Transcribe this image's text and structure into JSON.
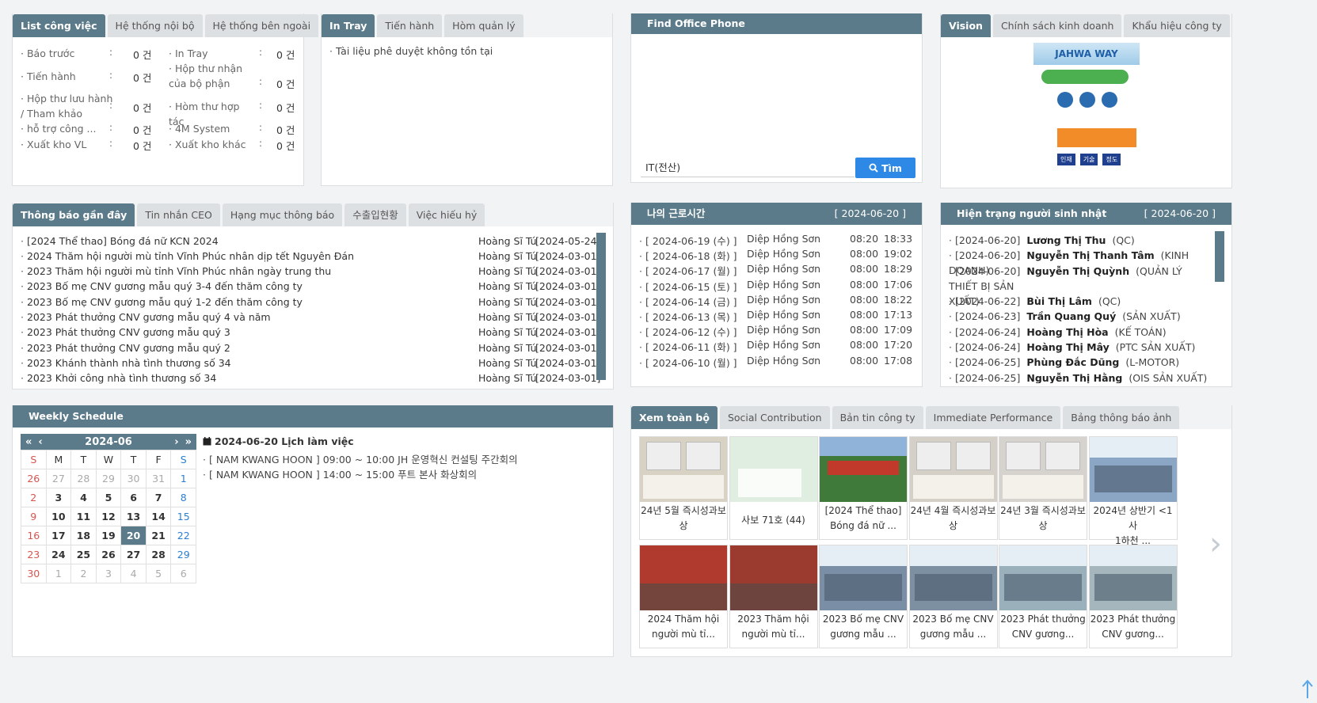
{
  "work_panel": {
    "tabs": [
      "List công việc",
      "Hệ thống nội bộ",
      "Hệ thống bên ngoài"
    ],
    "left_stats": [
      {
        "label": "Báo trước",
        "value": "0 건"
      },
      {
        "label": "Tiến hành",
        "value": "0 건"
      },
      {
        "label": "Hộp thư lưu hành / Tham khảo",
        "value": "0 건"
      },
      {
        "label": "hỗ trợ công ...",
        "value": "0 건"
      },
      {
        "label": "Xuất kho VL",
        "value": "0 건"
      }
    ],
    "right_stats": [
      {
        "label": "In Tray",
        "value": "0 건"
      },
      {
        "label": "Hộp thư nhận của bộ phận",
        "value": "0 건"
      },
      {
        "label": "Hòm thư hợp tác",
        "value": "0 건"
      },
      {
        "label": "4M System",
        "value": "0 건"
      },
      {
        "label": "Xuất kho khác",
        "value": "0 건"
      }
    ]
  },
  "tray_panel": {
    "tabs": [
      "In Tray",
      "Tiến hành",
      "Hòm quản lý"
    ],
    "message": "Tài liệu phê duyệt không tồn tại"
  },
  "phone_panel": {
    "title": "Find Office Phone",
    "input_value": "IT(전산)",
    "button_label": "Tìm"
  },
  "vision_panel": {
    "tabs": [
      "Vision",
      "Chính sách kinh doanh",
      "Khẩu hiệu công ty"
    ],
    "banner_title": "JAHWA WAY",
    "badges": [
      "인재",
      "기술",
      "정도"
    ]
  },
  "notice_panel": {
    "tabs": [
      "Thông báo gần đây",
      "Tin nhắn CEO",
      "Hạng mục thông báo",
      "수출입현황",
      "Việc hiếu hỷ"
    ],
    "items": [
      {
        "title": "[2024 Thể thao] Bóng đá nữ KCN 2024",
        "author": "Hoàng Sĩ Tú",
        "date": "[2024-05-24]"
      },
      {
        "title": "2024 Thăm hội người mù tỉnh Vĩnh Phúc nhân dịp tết Nguyên Đán",
        "author": "Hoàng Sĩ Tú",
        "date": "[2024-03-01]"
      },
      {
        "title": "2023 Thăm hội người mù tỉnh Vĩnh Phúc nhân ngày trung thu",
        "author": "Hoàng Sĩ Tú",
        "date": "[2024-03-01]"
      },
      {
        "title": "2023 Bố mẹ CNV gương mẫu quý 3-4 đến thăm công ty",
        "author": "Hoàng Sĩ Tú",
        "date": "[2024-03-01]"
      },
      {
        "title": "2023 Bố mẹ CNV gương mẫu quý 1-2 đến thăm công ty",
        "author": "Hoàng Sĩ Tú",
        "date": "[2024-03-01]"
      },
      {
        "title": "2023 Phát thưởng CNV gương mẫu quý 4 và năm",
        "author": "Hoàng Sĩ Tú",
        "date": "[2024-03-01]"
      },
      {
        "title": "2023 Phát thưởng CNV gương mẫu quý 3",
        "author": "Hoàng Sĩ Tú",
        "date": "[2024-03-01]"
      },
      {
        "title": "2023 Phát thưởng CNV gương mẫu quý 2",
        "author": "Hoàng Sĩ Tú",
        "date": "[2024-03-01]"
      },
      {
        "title": "2023 Khánh thành nhà tình thương số 34",
        "author": "Hoàng Sĩ Tú",
        "date": "[2024-03-01]"
      },
      {
        "title": "2023 Khởi công nhà tình thương số 34",
        "author": "Hoàng Sĩ Tú",
        "date": "[2024-03-01]"
      }
    ]
  },
  "worktime_panel": {
    "title": "나의 근로시간",
    "date": "[ 2024-06-20 ]",
    "rows": [
      {
        "date": "[ 2024-06-19 (수) ]",
        "name": "Diệp Hồng Sơn",
        "in": "08:20",
        "out": "18:33"
      },
      {
        "date": "[ 2024-06-18 (화) ]",
        "name": "Diệp Hồng Sơn",
        "in": "08:00",
        "out": "19:02"
      },
      {
        "date": "[ 2024-06-17 (월) ]",
        "name": "Diệp Hồng Sơn",
        "in": "08:00",
        "out": "18:29"
      },
      {
        "date": "[ 2024-06-15 (토) ]",
        "name": "Diệp Hồng Sơn",
        "in": "08:00",
        "out": "17:06"
      },
      {
        "date": "[ 2024-06-14 (금) ]",
        "name": "Diệp Hồng Sơn",
        "in": "08:00",
        "out": "18:22"
      },
      {
        "date": "[ 2024-06-13 (목) ]",
        "name": "Diệp Hồng Sơn",
        "in": "08:00",
        "out": "17:13"
      },
      {
        "date": "[ 2024-06-12 (수) ]",
        "name": "Diệp Hồng Sơn",
        "in": "08:00",
        "out": "17:09"
      },
      {
        "date": "[ 2024-06-11 (화) ]",
        "name": "Diệp Hồng Sơn",
        "in": "08:00",
        "out": "17:20"
      },
      {
        "date": "[ 2024-06-10 (월) ]",
        "name": "Diệp Hồng Sơn",
        "in": "08:00",
        "out": "17:08"
      }
    ]
  },
  "birthday_panel": {
    "title": "Hiện trạng người sinh nhật",
    "date": "[ 2024-06-20 ]",
    "rows": [
      {
        "date": "[2024-06-20]",
        "name": "Lương Thị Thu",
        "dept": "(QC)"
      },
      {
        "date": "[2024-06-20]",
        "name": "Nguyễn Thị Thanh Tâm",
        "dept": "(KINH DOANH)"
      },
      {
        "date": "[2024-06-20]",
        "name": "Nguyễn Thị Quỳnh",
        "dept": "(QUẢN LÝ THIẾT BỊ SẢN",
        "dept2": "XUẤT)"
      },
      {
        "date": "[2024-06-22]",
        "name": "Bùi Thị Lâm",
        "dept": "(QC)"
      },
      {
        "date": "[2024-06-23]",
        "name": "Trần Quang Quý",
        "dept": "(SẢN XUẤT)"
      },
      {
        "date": "[2024-06-24]",
        "name": "Hoàng Thị Hòa",
        "dept": "(KẾ TOÁN)"
      },
      {
        "date": "[2024-06-24]",
        "name": "Hoàng Thị Mây",
        "dept": "(PTC SẢN XUẤT)"
      },
      {
        "date": "[2024-06-25]",
        "name": "Phùng Đắc Dũng",
        "dept": "(L-MOTOR)"
      },
      {
        "date": "[2024-06-25]",
        "name": "Nguyễn Thị Hằng",
        "dept": "(OIS SẢN XUẤT)"
      }
    ]
  },
  "schedule_panel": {
    "title": "Weekly Schedule",
    "month": "2024-06",
    "weekdays": [
      "S",
      "M",
      "T",
      "W",
      "T",
      "F",
      "S"
    ],
    "days": [
      [
        "26",
        "27",
        "28",
        "29",
        "30",
        "31",
        "1"
      ],
      [
        "2",
        "3",
        "4",
        "5",
        "6",
        "7",
        "8"
      ],
      [
        "9",
        "10",
        "11",
        "12",
        "13",
        "14",
        "15"
      ],
      [
        "16",
        "17",
        "18",
        "19",
        "20",
        "21",
        "22"
      ],
      [
        "23",
        "24",
        "25",
        "26",
        "27",
        "28",
        "29"
      ],
      [
        "30",
        "1",
        "2",
        "3",
        "4",
        "5",
        "6"
      ]
    ],
    "today": "20",
    "heading": "2024-06-20 Lịch làm việc",
    "events": [
      "[ NAM KWANG HOON ] 09:00 ~ 10:00 JH 운영혁신 컨설팅 주간회의",
      "[ NAM KWANG HOON ] 14:00 ~ 15:00 푸트 본사 화상회의"
    ]
  },
  "gallery_panel": {
    "tabs": [
      "Xem toàn bộ",
      "Social Contribution",
      "Bản tin công ty",
      "Immediate Performance",
      "Bảng thông báo ảnh"
    ],
    "row1": [
      {
        "cap1": "24년 5월 즉시성과보",
        "cap2": "상",
        "bg": "#d8d2c4",
        "kind": "award"
      },
      {
        "cap1": "사보 71호 (44)",
        "cap2": "",
        "bg": "#dfeee0",
        "kind": "green"
      },
      {
        "cap1": "[2024 Thể thao]",
        "cap2": "Bóng đá nữ ...",
        "bg": "#3f7a3a",
        "kind": "field"
      },
      {
        "cap1": "24년 4월 즉시성과보",
        "cap2": "상",
        "bg": "#d4cfc7",
        "kind": "award"
      },
      {
        "cap1": "24년 3월 즉시성과보",
        "cap2": "상",
        "bg": "#d6d3cf",
        "kind": "award"
      },
      {
        "cap1": "2024년 상반기 <1사",
        "cap2": "1하천 ...",
        "bg": "#8aa6c4",
        "kind": "crowd"
      }
    ],
    "row2": [
      {
        "cap1": "2024 Thăm hội",
        "cap2": "người mù tỉ...",
        "bg": "#b03a2e",
        "kind": "red"
      },
      {
        "cap1": "2023 Thăm hội",
        "cap2": "người mù tỉ...",
        "bg": "#9b3b30",
        "kind": "red"
      },
      {
        "cap1": "2023 Bố mẹ CNV",
        "cap2": "gương mẫu ...",
        "bg": "#7a8fa6",
        "kind": "crowd"
      },
      {
        "cap1": "2023 Bố mẹ CNV",
        "cap2": "gương mẫu ...",
        "bg": "#7d90a2",
        "kind": "crowd"
      },
      {
        "cap1": "2023 Phát thưởng",
        "cap2": "CNV gương...",
        "bg": "#9ab0bb",
        "kind": "crowd"
      },
      {
        "cap1": "2023 Phát thưởng",
        "cap2": "CNV gương...",
        "bg": "#a6b6bd",
        "kind": "crowd"
      }
    ]
  }
}
